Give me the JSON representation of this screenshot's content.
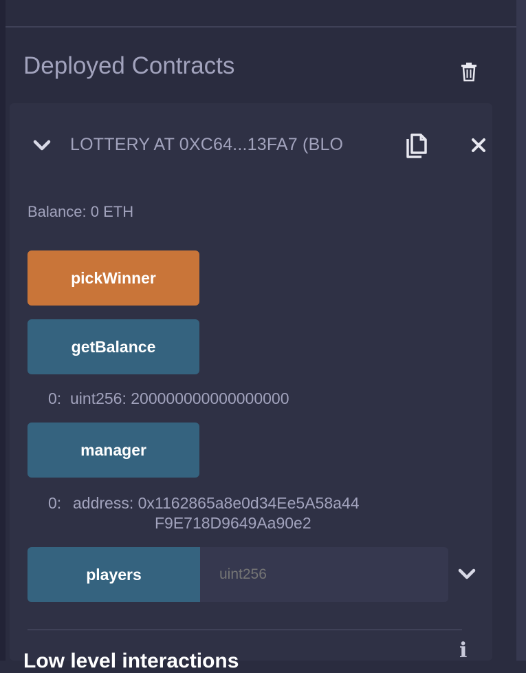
{
  "section_title": "Deployed Contracts",
  "contract": {
    "title": "LOTTERY AT 0XC64...13FA7 (BLO",
    "balance": "Balance: 0 ETH"
  },
  "functions": [
    {
      "label": "pickWinner",
      "color": "#c97539"
    },
    {
      "label": "getBalance",
      "color": "#35637f",
      "output_index": "0:",
      "output_value": "uint256: 200000000000000000"
    },
    {
      "label": "manager",
      "color": "#35637f",
      "output_index": "0:",
      "output_value_line1": "address: 0x1162865a8e0d34Ee5A58a44",
      "output_value_line2": "F9E718D9649Aa90e2"
    },
    {
      "label": "players",
      "color": "#35637f",
      "placeholder": "uint256"
    }
  ],
  "low_level": {
    "title": "Low level interactions"
  },
  "icons": {
    "trash": "trash-icon",
    "chevron": "chevron-down-icon",
    "copy": "copy-icon",
    "close": "close-icon",
    "info": "info-icon"
  }
}
